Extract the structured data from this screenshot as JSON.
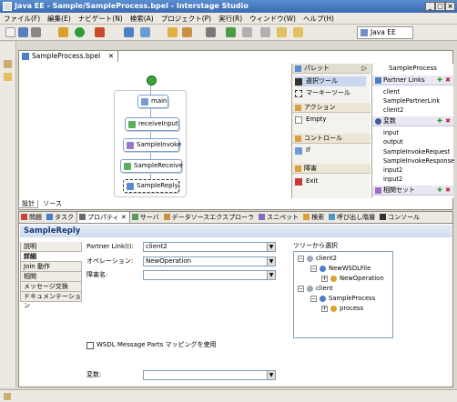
{
  "window": {
    "title": "Java EE - Sample/SampleProcess.bpel - Interstage Studio"
  },
  "menu": [
    "ファイル(F)",
    "編集(E)",
    "ナビゲート(N)",
    "検索(A)",
    "プロジェクト(P)",
    "実行(R)",
    "ウィンドウ(W)",
    "ヘルプ(H)"
  ],
  "toolbar": {
    "perspective": "Java EE"
  },
  "editor": {
    "tab_label": "SampleProcess.bpel",
    "bottom_tabs": [
      "設計",
      "ソース"
    ],
    "nodes": [
      {
        "label": "main"
      },
      {
        "label": "receiveInput"
      },
      {
        "label": "SampleInvoke"
      },
      {
        "label": "SampleReceive"
      },
      {
        "label": "SampleReply"
      }
    ]
  },
  "palette": {
    "title": "パレット",
    "sections": [
      {
        "title": "",
        "items": [
          "選択ツール",
          "マーキーツール"
        ]
      },
      {
        "title": "アクション",
        "items": [
          "Empty"
        ]
      },
      {
        "title": "コントロール",
        "items": [
          "If"
        ]
      },
      {
        "title": "障害",
        "items": [
          "Exit"
        ]
      }
    ]
  },
  "outline": {
    "title": "SampleProcess",
    "partner_links_title": "Partner Links",
    "partner_links": [
      "client",
      "SamplePartnerLink",
      "client2"
    ],
    "variables_title": "変数",
    "variables": [
      "input",
      "output",
      "SampleInvokeRequest",
      "SampleInvokeResponse",
      "input2",
      "input2"
    ],
    "correlation_title": "相関セット"
  },
  "views": {
    "tabs": [
      "問題",
      "タスク",
      "プロパティ",
      "サーバ",
      "データソースエクスプローラ",
      "スニペット",
      "検索",
      "呼び出し階層",
      "コンソール"
    ],
    "active_tab": "プロパティ"
  },
  "properties": {
    "title": "SampleReply",
    "side_tabs": [
      "説明",
      "詳細",
      "Join 動作",
      "相関",
      "メッセージ交換",
      "ドキュメンテーション"
    ],
    "active_side_tab": "詳細",
    "partner_link_label": "Partner Link(I):",
    "partner_link_value": "client2",
    "operation_label": "オペレーション:",
    "operation_value": "NewOperation",
    "fault_label": "障害名:",
    "fault_value": "",
    "wsdl_checkbox_label": "WSDL Message Parts マッピングを使用",
    "variable_label": "変数:",
    "variable_value": "",
    "tree_title": "ツリーから選択",
    "tree": [
      {
        "label": "client2",
        "level": 0,
        "expander": "−",
        "color": "#9aa8b8"
      },
      {
        "label": "NewWSDLFile",
        "level": 1,
        "expander": "−",
        "color": "#4a7fd0"
      },
      {
        "label": "NewOperation",
        "level": 2,
        "expander": "+",
        "color": "#e0a030"
      },
      {
        "label": "client",
        "level": 0,
        "expander": "−",
        "color": "#9aa8b8"
      },
      {
        "label": "SampleProcess",
        "level": 1,
        "expander": "−",
        "color": "#4a7fd0"
      },
      {
        "label": "process",
        "level": 2,
        "expander": "+",
        "color": "#e0a030"
      }
    ]
  }
}
